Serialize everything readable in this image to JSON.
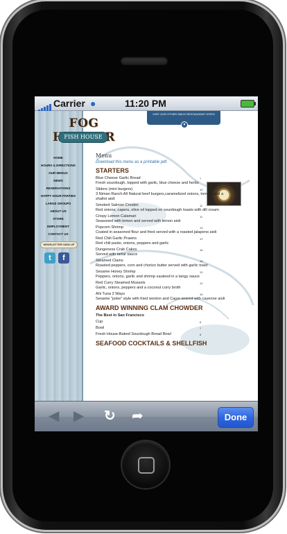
{
  "status_bar": {
    "carrier": "Carrier",
    "time": "11:20 PM",
    "wifi_icon": "wifi-icon",
    "battery_icon": "battery-icon"
  },
  "site": {
    "logo_title": "FOG HARBOR",
    "logo_subtitle": "FISH HOUSE",
    "banner_text": "VISIT OUR OTHER SMCO RESTAURANT SITES!",
    "nav": [
      "HOME",
      "HOURS & DIRECTIONS",
      "OUR MENUS",
      "NEWS",
      "RESERVATIONS",
      "HAPPY HOUR PARTIES",
      "LARGE GROUPS",
      "ABOUT US",
      "STORE",
      "EMPLOYMENT",
      "CONTACT US"
    ],
    "newsletter": "NEWSLETTER SIGN UP"
  },
  "menu": {
    "title": "Menu",
    "printable": "Download this menu as a printable pdf.",
    "starters_title": "STARTERS",
    "starters": [
      {
        "name": "Blue Cheese Garlic Bread",
        "desc": "Fresh sourdough, topped with garlic, blue cheese and herbs",
        "price": "7"
      },
      {
        "name": "Sliders (mini burgers)",
        "desc": "3 Niman Ranch All Natural beef burgers,caramelized onions, tomato and a shallot aioli",
        "price": "10"
      },
      {
        "name": "Smoked Salmon Crostini",
        "desc": "Red onions, capers, olive oil topped on sourdough toasts with dill cream",
        "price": "11"
      },
      {
        "name": "Crispy Lemon Calamari",
        "desc": "Seasoned with lemon and served with lemon aioli",
        "price": "11"
      },
      {
        "name": "Popcorn Shrimp",
        "desc": "Coated in seasoned flour and fried served with a roasted jalapeno aioli",
        "price": "13"
      },
      {
        "name": "Red Chili Garlic Prawns",
        "desc": "Red chili paste, onions, peppers and garlic",
        "price": "12"
      },
      {
        "name": "Dungeness Crab Cakes",
        "desc": "Served with tartar sauce",
        "price": "16"
      },
      {
        "name": "Steamed Clams",
        "desc": "Roasted peppers, corn and chorizo butter served with garlic toast",
        "price": "16"
      },
      {
        "name": "Sesame Honey Shrimp",
        "desc": "Peppers, onions, garlic and shrimp sauteed in a tangy sauce",
        "price": "13"
      },
      {
        "name": "Red Curry Steamed Mussels",
        "desc": "Garlic, onions, peppers and a coconut curry broth",
        "price": "12"
      },
      {
        "name": "Ahi Tuna 2 Ways",
        "desc": "Sesame \"poke\" style with fried wonton and Cajun seared with cayenne aioli",
        "price": "15"
      }
    ],
    "chowder_title": "AWARD WINNING CLAM CHOWDER",
    "chowder_sub": "The Best in San Francisco",
    "chowder": [
      {
        "name": "Cup",
        "price": "6"
      },
      {
        "name": "Bowl",
        "price": "7"
      },
      {
        "name": "Fresh House-Baked Sourdough Bread Bowl",
        "price": "8"
      }
    ],
    "seafood_title": "SEAFOOD COCKTAILS & SHELLFISH"
  },
  "toolbar": {
    "back_icon": "back-arrow-icon",
    "forward_icon": "forward-arrow-icon",
    "reload_icon": "reload-icon",
    "share_icon": "share-icon",
    "done_label": "Done"
  }
}
